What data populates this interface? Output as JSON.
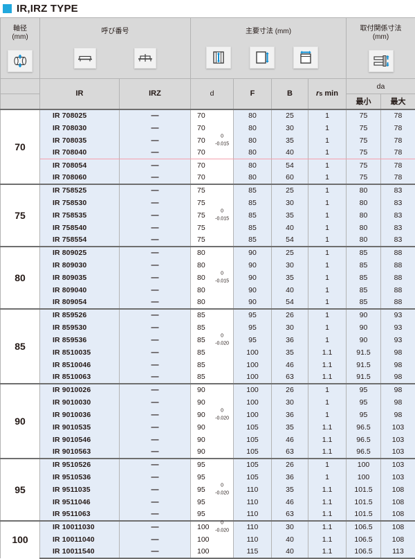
{
  "title": {
    "text": "IR,IRZ  TYPE",
    "accent_color": "#21a8dd"
  },
  "header": {
    "shaft_dia": {
      "line1": "軸径",
      "line2": "(mm)",
      "icon": "shaft-cylinder-icon"
    },
    "designation": {
      "label": "呼び番号",
      "icons": [
        "ir-profile-icon",
        "irz-profile-icon"
      ]
    },
    "main_dims": {
      "label": "主要寸法 (mm)",
      "icons": [
        "dim-d-icon",
        "dim-f-icon",
        "dim-b-icon"
      ]
    },
    "mount_dims": {
      "line1": "取付関係寸法",
      "line2": "(mm)",
      "icon": "mounting-icon"
    },
    "columns": {
      "ir": "IR",
      "irz": "IRZ",
      "d": "d",
      "f": "F",
      "b": "B",
      "rs_min_r": "r",
      "rs_min_s": "s",
      "rs_min_tail": " min",
      "da": "da",
      "da_min": "最小",
      "da_max": "最大"
    }
  },
  "colors": {
    "row_blue": "#e4ecf7",
    "header_gray": "#d9d9d9",
    "highlight_pink": "#f4a0ad",
    "text": "#231815"
  },
  "groups": [
    {
      "shaft": "70",
      "tolerance": {
        "upper": "0",
        "lower": "-0.015",
        "span_start": 2,
        "span_end": 3
      },
      "highlight_after_row": 3,
      "rows": [
        {
          "ir": "IR 708025",
          "irz": "—",
          "d": "70",
          "f": "80",
          "b": "25",
          "rs": "1",
          "da_min": "75",
          "da_max": "78"
        },
        {
          "ir": "IR 708030",
          "irz": "—",
          "d": "70",
          "f": "80",
          "b": "30",
          "rs": "1",
          "da_min": "75",
          "da_max": "78"
        },
        {
          "ir": "IR 708035",
          "irz": "—",
          "d": "70",
          "f": "80",
          "b": "35",
          "rs": "1",
          "da_min": "75",
          "da_max": "78"
        },
        {
          "ir": "IR 708040",
          "irz": "—",
          "d": "70",
          "f": "80",
          "b": "40",
          "rs": "1",
          "da_min": "75",
          "da_max": "78"
        },
        {
          "ir": "IR 708054",
          "irz": "—",
          "d": "70",
          "f": "80",
          "b": "54",
          "rs": "1",
          "da_min": "75",
          "da_max": "78"
        },
        {
          "ir": "IR 708060",
          "irz": "—",
          "d": "70",
          "f": "80",
          "b": "60",
          "rs": "1",
          "da_min": "75",
          "da_max": "78"
        }
      ]
    },
    {
      "shaft": "75",
      "tolerance": {
        "upper": "0",
        "lower": "-0.015",
        "span_start": 2,
        "span_end": 2
      },
      "highlight_after_row": -1,
      "rows": [
        {
          "ir": "IR 758525",
          "irz": "—",
          "d": "75",
          "f": "85",
          "b": "25",
          "rs": "1",
          "da_min": "80",
          "da_max": "83"
        },
        {
          "ir": "IR 758530",
          "irz": "—",
          "d": "75",
          "f": "85",
          "b": "30",
          "rs": "1",
          "da_min": "80",
          "da_max": "83"
        },
        {
          "ir": "IR 758535",
          "irz": "—",
          "d": "75",
          "f": "85",
          "b": "35",
          "rs": "1",
          "da_min": "80",
          "da_max": "83"
        },
        {
          "ir": "IR 758540",
          "irz": "—",
          "d": "75",
          "f": "85",
          "b": "40",
          "rs": "1",
          "da_min": "80",
          "da_max": "83"
        },
        {
          "ir": "IR 758554",
          "irz": "—",
          "d": "75",
          "f": "85",
          "b": "54",
          "rs": "1",
          "da_min": "80",
          "da_max": "83"
        }
      ]
    },
    {
      "shaft": "80",
      "tolerance": {
        "upper": "0",
        "lower": "-0.015",
        "span_start": 2,
        "span_end": 2
      },
      "highlight_after_row": -1,
      "rows": [
        {
          "ir": "IR 809025",
          "irz": "—",
          "d": "80",
          "f": "90",
          "b": "25",
          "rs": "1",
          "da_min": "85",
          "da_max": "88"
        },
        {
          "ir": "IR 809030",
          "irz": "—",
          "d": "80",
          "f": "90",
          "b": "30",
          "rs": "1",
          "da_min": "85",
          "da_max": "88"
        },
        {
          "ir": "IR 809035",
          "irz": "—",
          "d": "80",
          "f": "90",
          "b": "35",
          "rs": "1",
          "da_min": "85",
          "da_max": "88"
        },
        {
          "ir": "IR 809040",
          "irz": "—",
          "d": "80",
          "f": "90",
          "b": "40",
          "rs": "1",
          "da_min": "85",
          "da_max": "88"
        },
        {
          "ir": "IR 809054",
          "irz": "—",
          "d": "80",
          "f": "90",
          "b": "54",
          "rs": "1",
          "da_min": "85",
          "da_max": "88"
        }
      ]
    },
    {
      "shaft": "85",
      "tolerance": {
        "upper": "0",
        "lower": "-0.020",
        "span_start": 2,
        "span_end": 3
      },
      "highlight_after_row": -1,
      "rows": [
        {
          "ir": "IR 859526",
          "irz": "—",
          "d": "85",
          "f": "95",
          "b": "26",
          "rs": "1",
          "da_min": "90",
          "da_max": "93"
        },
        {
          "ir": "IR 859530",
          "irz": "—",
          "d": "85",
          "f": "95",
          "b": "30",
          "rs": "1",
          "da_min": "90",
          "da_max": "93"
        },
        {
          "ir": "IR 859536",
          "irz": "—",
          "d": "85",
          "f": "95",
          "b": "36",
          "rs": "1",
          "da_min": "90",
          "da_max": "93"
        },
        {
          "ir": "IR 8510035",
          "irz": "—",
          "d": "85",
          "f": "100",
          "b": "35",
          "rs": "1.1",
          "da_min": "91.5",
          "da_max": "98"
        },
        {
          "ir": "IR 8510046",
          "irz": "—",
          "d": "85",
          "f": "100",
          "b": "46",
          "rs": "1.1",
          "da_min": "91.5",
          "da_max": "98"
        },
        {
          "ir": "IR 8510063",
          "irz": "—",
          "d": "85",
          "f": "100",
          "b": "63",
          "rs": "1.1",
          "da_min": "91.5",
          "da_max": "98"
        }
      ]
    },
    {
      "shaft": "90",
      "tolerance": {
        "upper": "0",
        "lower": "-0.020",
        "span_start": 2,
        "span_end": 3
      },
      "highlight_after_row": -1,
      "rows": [
        {
          "ir": "IR 9010026",
          "irz": "—",
          "d": "90",
          "f": "100",
          "b": "26",
          "rs": "1",
          "da_min": "95",
          "da_max": "98"
        },
        {
          "ir": "IR 9010030",
          "irz": "—",
          "d": "90",
          "f": "100",
          "b": "30",
          "rs": "1",
          "da_min": "95",
          "da_max": "98"
        },
        {
          "ir": "IR 9010036",
          "irz": "—",
          "d": "90",
          "f": "100",
          "b": "36",
          "rs": "1",
          "da_min": "95",
          "da_max": "98"
        },
        {
          "ir": "IR 9010535",
          "irz": "—",
          "d": "90",
          "f": "105",
          "b": "35",
          "rs": "1.1",
          "da_min": "96.5",
          "da_max": "103"
        },
        {
          "ir": "IR 9010546",
          "irz": "—",
          "d": "90",
          "f": "105",
          "b": "46",
          "rs": "1.1",
          "da_min": "96.5",
          "da_max": "103"
        },
        {
          "ir": "IR 9010563",
          "irz": "—",
          "d": "90",
          "f": "105",
          "b": "63",
          "rs": "1.1",
          "da_min": "96.5",
          "da_max": "103"
        }
      ]
    },
    {
      "shaft": "95",
      "tolerance": {
        "upper": "0",
        "lower": "-0.020",
        "span_start": 2,
        "span_end": 2
      },
      "highlight_after_row": -1,
      "rows": [
        {
          "ir": "IR 9510526",
          "irz": "—",
          "d": "95",
          "f": "105",
          "b": "26",
          "rs": "1",
          "da_min": "100",
          "da_max": "103"
        },
        {
          "ir": "IR 9510536",
          "irz": "—",
          "d": "95",
          "f": "105",
          "b": "36",
          "rs": "1",
          "da_min": "100",
          "da_max": "103"
        },
        {
          "ir": "IR 9511035",
          "irz": "—",
          "d": "95",
          "f": "110",
          "b": "35",
          "rs": "1.1",
          "da_min": "101.5",
          "da_max": "108"
        },
        {
          "ir": "IR 9511046",
          "irz": "—",
          "d": "95",
          "f": "110",
          "b": "46",
          "rs": "1.1",
          "da_min": "101.5",
          "da_max": "108"
        },
        {
          "ir": "IR 9511063",
          "irz": "—",
          "d": "95",
          "f": "110",
          "b": "63",
          "rs": "1.1",
          "da_min": "101.5",
          "da_max": "108"
        }
      ]
    },
    {
      "shaft": "100",
      "tolerance": {
        "upper": "0",
        "lower": "-0.020",
        "span_start": 0,
        "span_end": 1
      },
      "highlight_after_row": -1,
      "rows": [
        {
          "ir": "IR 10011030",
          "irz": "—",
          "d": "100",
          "f": "110",
          "b": "30",
          "rs": "1.1",
          "da_min": "106.5",
          "da_max": "108"
        },
        {
          "ir": "IR 10011040",
          "irz": "—",
          "d": "100",
          "f": "110",
          "b": "40",
          "rs": "1.1",
          "da_min": "106.5",
          "da_max": "108"
        },
        {
          "ir": "IR 10011540",
          "irz": "—",
          "d": "100",
          "f": "115",
          "b": "40",
          "rs": "1.1",
          "da_min": "106.5",
          "da_max": "113"
        }
      ]
    }
  ]
}
